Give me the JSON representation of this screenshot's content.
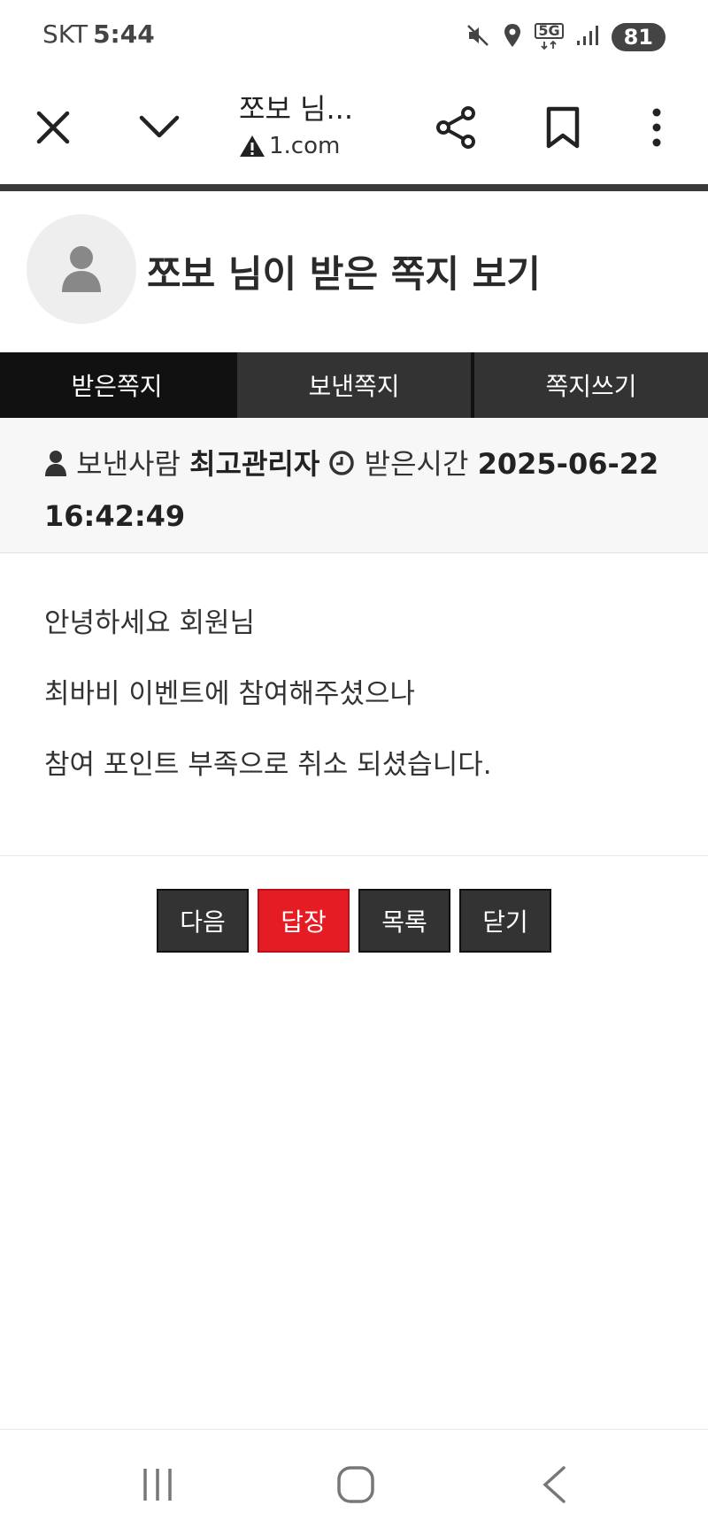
{
  "status_bar": {
    "carrier": "SKT",
    "time": "5:44",
    "battery": "81",
    "network": "5G"
  },
  "browser": {
    "page_title": "쪼보 님...",
    "url": "1.com"
  },
  "header": {
    "title": "쪼보 님이 받은 쪽지 보기"
  },
  "tabs": [
    {
      "label": "받은쪽지",
      "active": true
    },
    {
      "label": "보낸쪽지",
      "active": false
    },
    {
      "label": "쪽지쓰기",
      "active": false
    }
  ],
  "message_info": {
    "sender_label": "보낸사람",
    "sender_name": "최고관리자",
    "time_label": "받은시간",
    "time_value": "2025-06-22 16:42:49"
  },
  "message_body": [
    "안녕하세요 회원님",
    "최바비 이벤트에 참여해주셨으나",
    "참여 포인트 부족으로 취소 되셨습니다."
  ],
  "actions": {
    "next": "다음",
    "reply": "답장",
    "list": "목록",
    "close": "닫기"
  },
  "colors": {
    "accent_red": "#e51c23",
    "dark": "#333333",
    "active_tab": "#111111"
  }
}
